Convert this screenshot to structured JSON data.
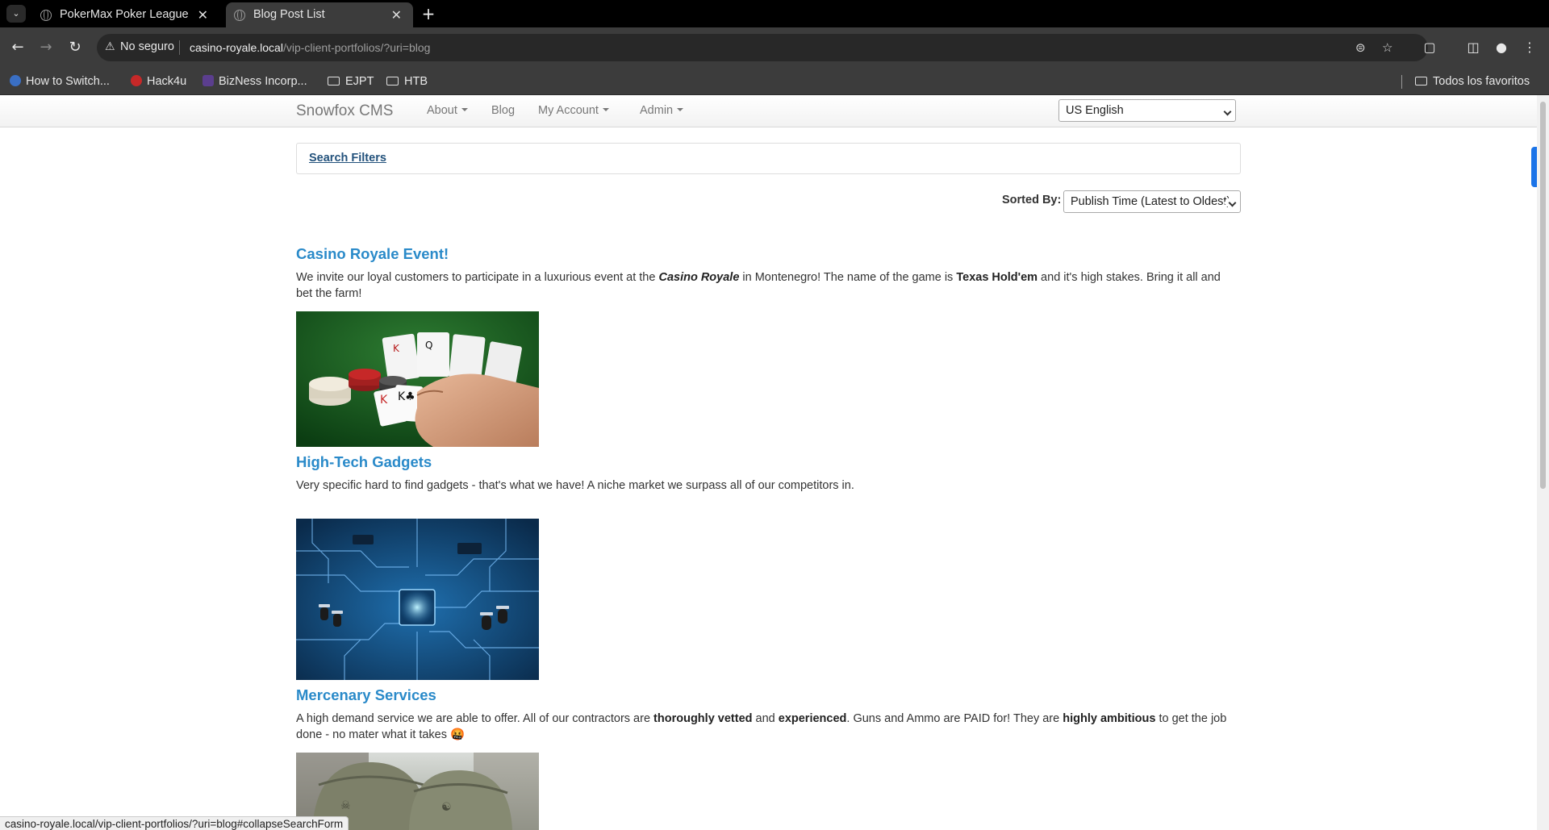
{
  "browser": {
    "tabs": [
      {
        "title": "PokerMax Poker League",
        "active": false
      },
      {
        "title": "Blog Post List",
        "active": true
      }
    ],
    "address": {
      "security_label": "No seguro",
      "host": "casino-royale.local",
      "path": "/vip-client-portfolios/?uri=blog"
    },
    "bookmarks": [
      {
        "label": "How to Switch...",
        "icon": "bookmark-favicon"
      },
      {
        "label": "Hack4u",
        "icon": "hack4u-favicon"
      },
      {
        "label": "BizNess Incorp...",
        "icon": "bizness-favicon"
      },
      {
        "label": "EJPT",
        "icon": "folder-icon"
      },
      {
        "label": "HTB",
        "icon": "folder-icon"
      }
    ],
    "all_bookmarks_label": "Todos los favoritos",
    "status_url": "casino-royale.local/vip-client-portfolios/?uri=blog#collapseSearchForm"
  },
  "site": {
    "brand": "Snowfox CMS",
    "nav": [
      {
        "label": "About",
        "dropdown": true
      },
      {
        "label": "Blog",
        "dropdown": false
      },
      {
        "label": "My Account",
        "dropdown": true
      },
      {
        "label": "Admin",
        "dropdown": true
      }
    ],
    "language": "US English"
  },
  "filters": {
    "search_filters_label": "Search Filters",
    "sorted_by_label": "Sorted By:",
    "sorted_by_value": "Publish Time (Latest to Oldest)"
  },
  "posts": [
    {
      "title": "Casino Royale Event!",
      "text_parts": [
        "We invite our loyal customers to participate in a luxurious event at the ",
        "Casino Royale",
        " in Montenegro! The name of the game is ",
        "Texas Hold'em",
        " and it's high stakes. Bring it all and bet the farm!"
      ]
    },
    {
      "title": "High-Tech Gadgets",
      "text": "Very specific hard to find gadgets - that's what we have! A niche market we surpass all of our competitors in."
    },
    {
      "title": "Mercenary Services",
      "text_parts": [
        "A high demand service we are able to offer. All of our contractors are ",
        "thoroughly vetted",
        " and ",
        "experienced",
        ". Guns and Ammo are PAID for! They are ",
        "highly ambitious",
        " to get the job done - no mater what it takes ",
        "🤬"
      ]
    }
  ],
  "colors": {
    "link": "#2a8ac9",
    "chrome_dark": "#3c3c3c",
    "tabbar": "#000000"
  }
}
